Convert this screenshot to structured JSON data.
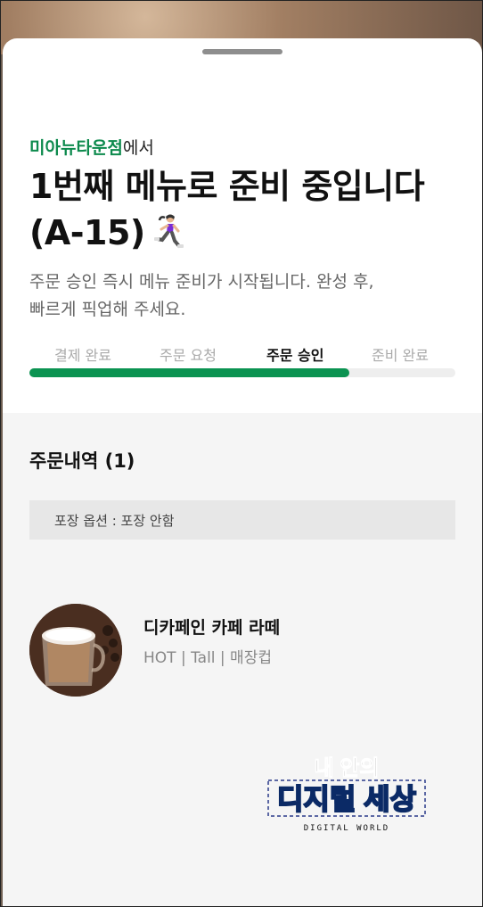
{
  "store": {
    "name": "미아뉴타운점",
    "suffix": "에서"
  },
  "title": {
    "line1": "1번째 메뉴로 준비 중입니다",
    "line2": "(A-15)"
  },
  "description": {
    "line1": "주문 승인 즉시 메뉴 준비가 시작됩니다. 완성 후,",
    "line2": "빠르게 픽업해 주세요."
  },
  "steps": [
    {
      "label": "결제 완료",
      "active": false
    },
    {
      "label": "주문 요청",
      "active": false
    },
    {
      "label": "주문 승인",
      "active": true
    },
    {
      "label": "준비 완료",
      "active": false
    }
  ],
  "progress": {
    "fraction": 0.75,
    "color": "#0b9351"
  },
  "order": {
    "heading": "주문내역 (1)",
    "packaging": "포장 옵션 : 포장 안함",
    "items": [
      {
        "name": "디카페인 카페 라떼",
        "options": "HOT | Tall | 매장컵"
      }
    ]
  },
  "watermark": {
    "line1": "내 안의",
    "line2": "디지털 세상",
    "line3": "DIGITAL WORLD"
  },
  "colors": {
    "accent": "#0d8a4d",
    "progress": "#0b9351"
  }
}
